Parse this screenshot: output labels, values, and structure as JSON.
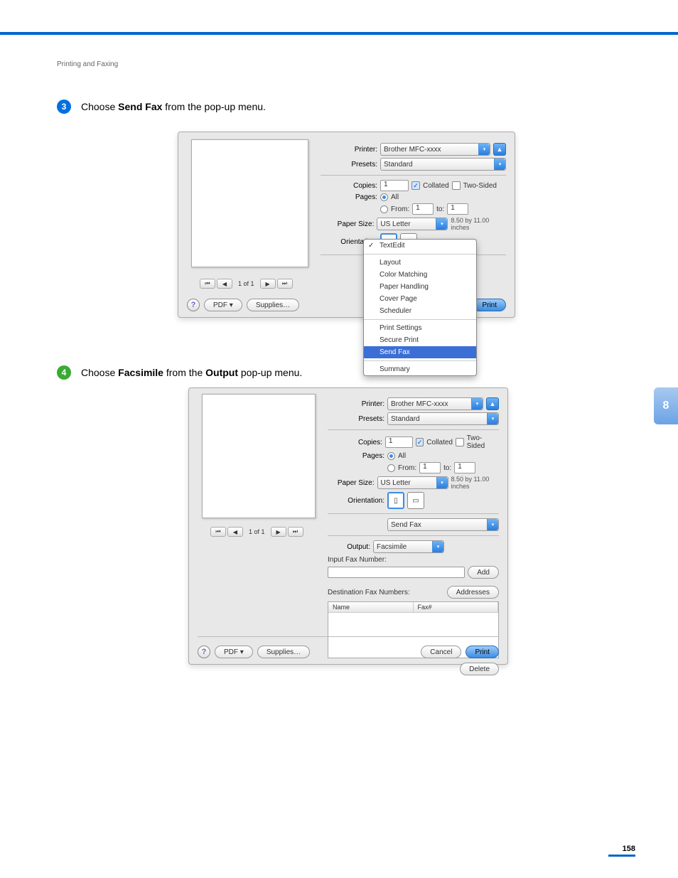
{
  "header": {
    "section": "Printing and Faxing",
    "page_number": "158",
    "side_tab": "8"
  },
  "steps": {
    "s3": {
      "number": "3",
      "pre": "Choose ",
      "bold": "Send Fax",
      "post": " from the pop-up menu."
    },
    "s4": {
      "number": "4",
      "pre": "Choose ",
      "bold1": "Facsimile",
      "mid": " from the ",
      "bold2": "Output",
      "post": " pop-up menu."
    }
  },
  "dlg1": {
    "printer_lbl": "Printer:",
    "printer_val": "Brother MFC-xxxx",
    "presets_lbl": "Presets:",
    "presets_val": "Standard",
    "copies_lbl": "Copies:",
    "copies_val": "1",
    "collated": "Collated",
    "twosided": "Two-Sided",
    "pages_lbl": "Pages:",
    "all": "All",
    "from_lbl": "From:",
    "from_val": "1",
    "to_lbl": "to:",
    "to_val": "1",
    "papersize_lbl": "Paper Size:",
    "papersize_val": "US Letter",
    "papersize_dim": "8.50 by 11.00 inches",
    "orientation_lbl": "Orientation:",
    "menu": {
      "textedit": "TextEdit",
      "layout": "Layout",
      "colormatch": "Color Matching",
      "paperhandling": "Paper Handling",
      "coverpage": "Cover Page",
      "scheduler": "Scheduler",
      "printsettings": "Print Settings",
      "secureprint": "Secure Print",
      "sendfax": "Send Fax",
      "summary": "Summary"
    },
    "preview_nav": "1 of 1",
    "help": "?",
    "pdf": "PDF ▾",
    "supplies": "Supplies…",
    "print": "Print"
  },
  "dlg2": {
    "printer_lbl": "Printer:",
    "printer_val": "Brother MFC-xxxx",
    "presets_lbl": "Presets:",
    "presets_val": "Standard",
    "copies_lbl": "Copies:",
    "copies_val": "1",
    "collated": "Collated",
    "twosided": "Two-Sided",
    "pages_lbl": "Pages:",
    "all": "All",
    "from_lbl": "From:",
    "from_val": "1",
    "to_lbl": "to:",
    "to_val": "1",
    "papersize_lbl": "Paper Size:",
    "papersize_val": "US Letter",
    "papersize_dim": "8.50 by 11.00 inches",
    "orientation_lbl": "Orientation:",
    "panel_val": "Send Fax",
    "output_lbl": "Output:",
    "output_val": "Facsimile",
    "inputfax_lbl": "Input Fax Number:",
    "add_btn": "Add",
    "destfax_lbl": "Destination Fax Numbers:",
    "addresses_btn": "Addresses",
    "col_name": "Name",
    "col_fax": "Fax#",
    "delete_btn": "Delete",
    "preview_nav": "1 of 1",
    "help": "?",
    "pdf": "PDF ▾",
    "supplies": "Supplies…",
    "cancel": "Cancel",
    "print": "Print"
  }
}
